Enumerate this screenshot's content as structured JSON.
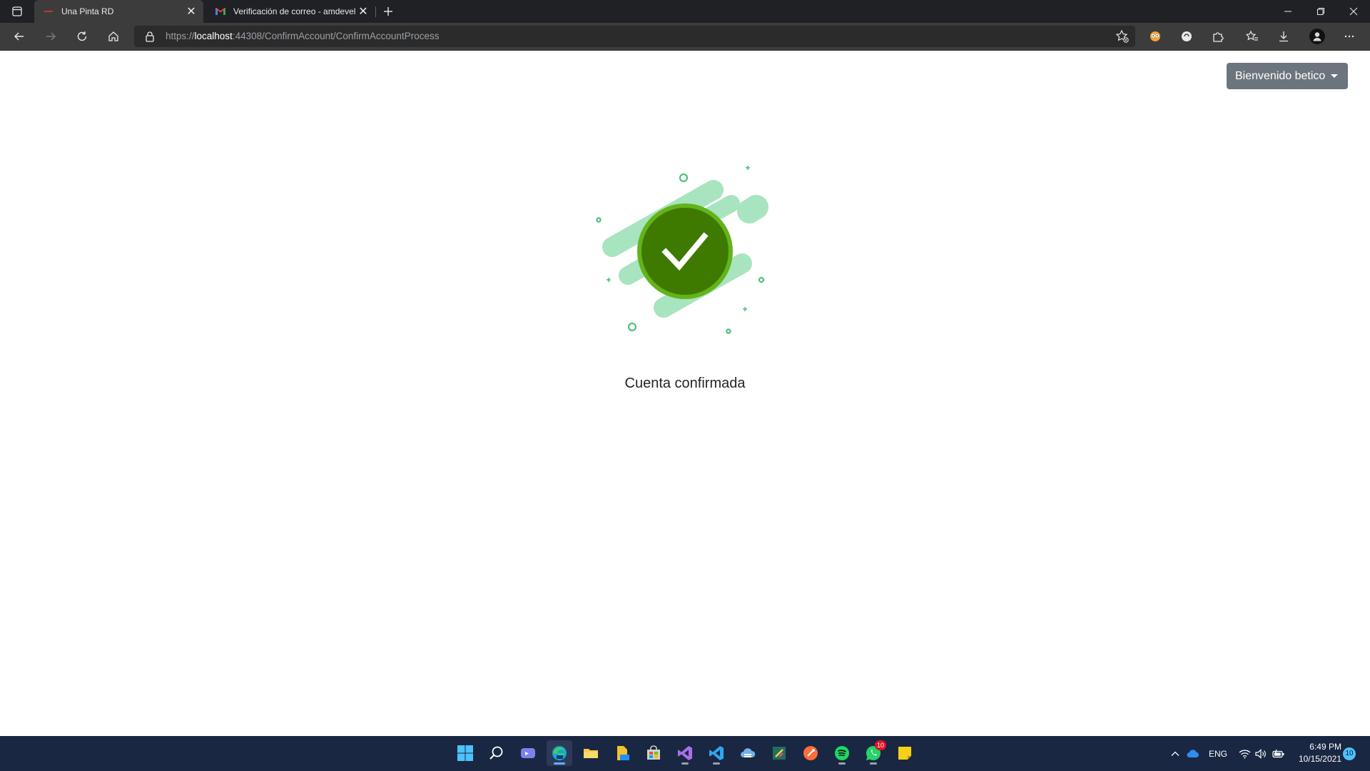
{
  "browser": {
    "tabs": [
      {
        "title": "Una Pinta RD",
        "active": true,
        "icon": "una-pinta-favicon"
      },
      {
        "title": "Verificación de correo - amdevel",
        "active": false,
        "icon": "gmail-icon"
      }
    ],
    "address": {
      "scheme": "https://",
      "host": "localhost",
      "rest": ":44308/ConfirmAccount/ConfirmAccountProcess"
    }
  },
  "page": {
    "user_menu_label": "Bienvenido betico",
    "message": "Cuenta confirmada",
    "colors": {
      "check_dark": "#3e7a00",
      "check_ring": "#63b31a",
      "blob": "#a8e4bf",
      "accent": "#4cc27a",
      "button": "#6c757d"
    }
  },
  "taskbar": {
    "apps": [
      {
        "name": "start",
        "icon": "windows-start-icon"
      },
      {
        "name": "search",
        "icon": "search-icon"
      },
      {
        "name": "teams-chat",
        "icon": "chat-icon"
      },
      {
        "name": "edge",
        "icon": "edge-icon",
        "active": true
      },
      {
        "name": "file-explorer",
        "icon": "folder-icon"
      },
      {
        "name": "sticky-files",
        "icon": "file-icon"
      },
      {
        "name": "store",
        "icon": "store-icon"
      },
      {
        "name": "visual-studio",
        "icon": "visual-studio-icon"
      },
      {
        "name": "vscode",
        "icon": "vscode-icon"
      },
      {
        "name": "azure-data-studio",
        "icon": "cloud-app-icon"
      },
      {
        "name": "sql-tool",
        "icon": "tool-icon"
      },
      {
        "name": "postman",
        "icon": "postman-icon"
      },
      {
        "name": "spotify",
        "icon": "spotify-icon"
      },
      {
        "name": "whatsapp",
        "icon": "whatsapp-icon",
        "badge": "10"
      },
      {
        "name": "sticky-notes",
        "icon": "sticky-notes-icon"
      }
    ],
    "tray": {
      "language": "ENG",
      "time": "6:49 PM",
      "date": "10/15/2021",
      "notifications": "10"
    }
  }
}
